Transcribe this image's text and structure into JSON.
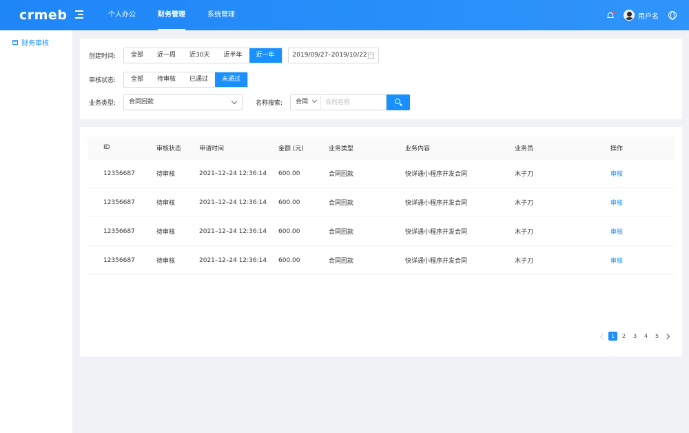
{
  "header": {
    "logo": "crmeb",
    "nav": [
      "个人办公",
      "财务管理",
      "系统管理"
    ],
    "active_nav": 1,
    "username": "用户名"
  },
  "sidebar": {
    "items": [
      {
        "label": "财务审核",
        "icon": "calendar-icon"
      }
    ]
  },
  "filters": {
    "time_label": "创建时间:",
    "time_options": [
      "全部",
      "近一周",
      "近30天",
      "近半年",
      "近一年"
    ],
    "time_active": 4,
    "date_range": "2019/09/27–2019/10/22",
    "status_label": "审核状态:",
    "status_options": [
      "全部",
      "待审核",
      "已通过",
      "未通过"
    ],
    "status_active": 3,
    "type_label": "业务类型:",
    "type_value": "合同回款",
    "search_label": "名称搜索:",
    "search_prefix": "合同",
    "search_placeholder": "合同名称"
  },
  "table": {
    "columns": [
      "ID",
      "审核状态",
      "申请时间",
      "金额 (元)",
      "业务类型",
      "业务内容",
      "业务员",
      "操作"
    ],
    "rows": [
      [
        "12356687",
        "待审核",
        "2021–12–24 12:36:14",
        "600.00",
        "合同回款",
        "快详通小程序开发合同",
        "木子刀",
        "审核"
      ],
      [
        "12356687",
        "待审核",
        "2021–12–24 12:36:14",
        "600.00",
        "合同回款",
        "快详通小程序开发合同",
        "木子刀",
        "审核"
      ],
      [
        "12356687",
        "待审核",
        "2021–12–24 12:36:14",
        "600.00",
        "合同回款",
        "快详通小程序开发合同",
        "木子刀",
        "审核"
      ],
      [
        "12356687",
        "待审核",
        "2021–12–24 12:36:14",
        "600.00",
        "合同回款",
        "快详通小程序开发合同",
        "木子刀",
        "审核"
      ]
    ]
  },
  "pagination": {
    "pages": [
      "1",
      "2",
      "3",
      "4",
      "5"
    ],
    "current": 0
  },
  "colors": {
    "primary": "#1890ff",
    "header": "#2f95fb"
  }
}
